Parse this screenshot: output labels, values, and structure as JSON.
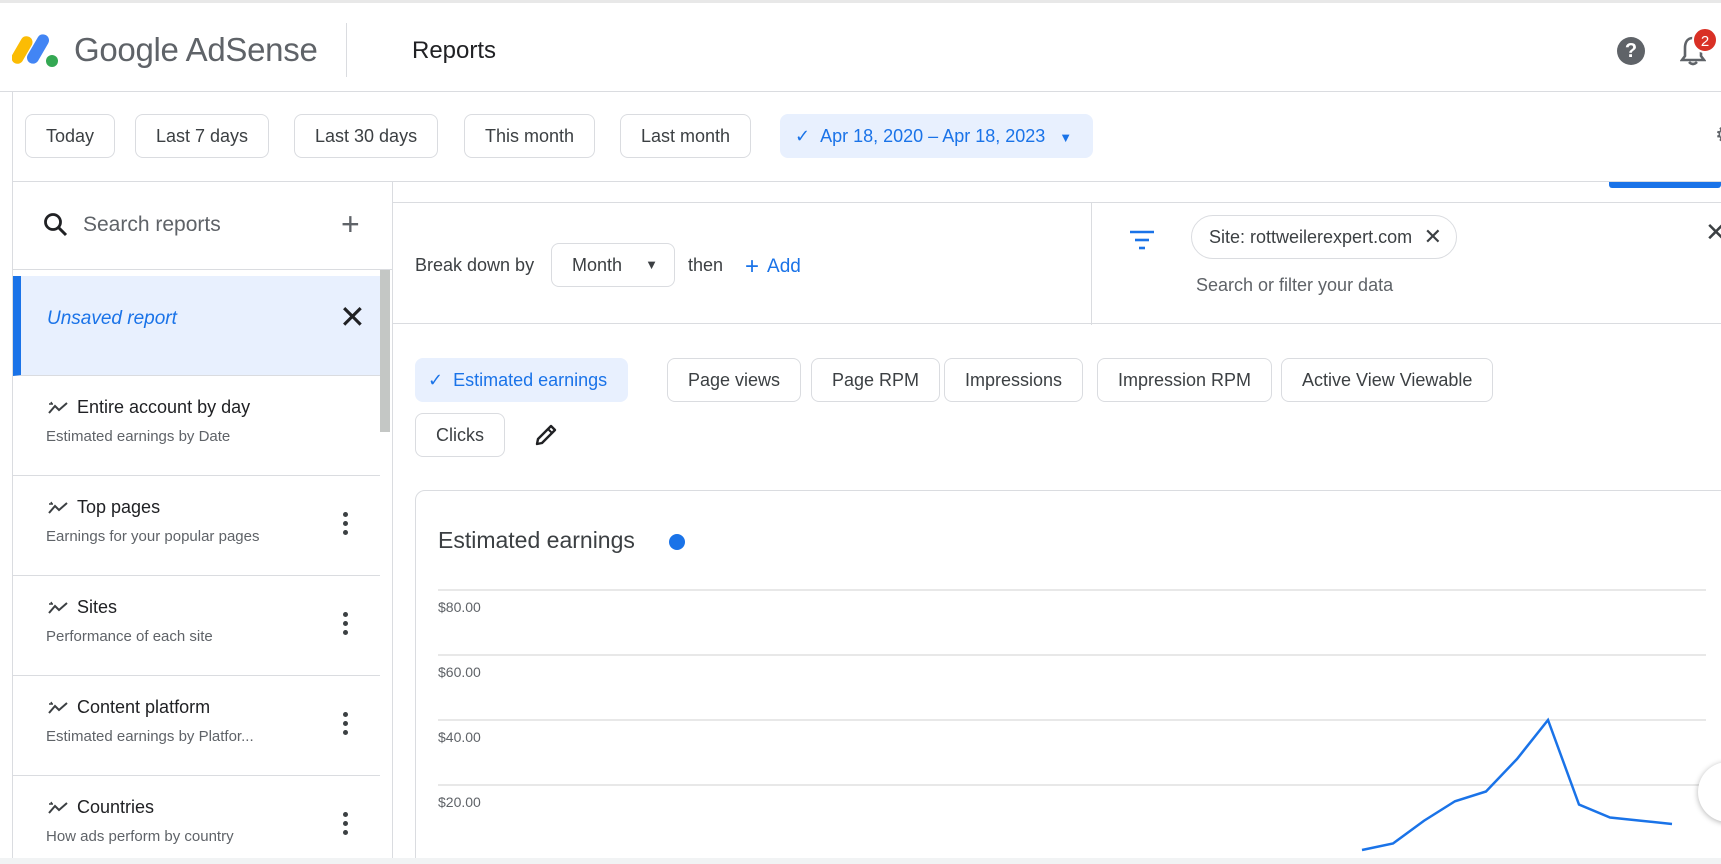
{
  "app": {
    "brand": "Google AdSense",
    "page_title": "Reports",
    "notifications_count": "2",
    "help_glyph": "?"
  },
  "date_range": {
    "chips": [
      "Today",
      "Last 7 days",
      "Last 30 days",
      "This month",
      "Last month"
    ],
    "selected": "Apr 18, 2020 – Apr 18, 2023"
  },
  "sidebar": {
    "search_placeholder": "Search reports",
    "unsaved_label": "Unsaved report",
    "reports": [
      {
        "title": "Entire account by day",
        "subtitle": "Estimated earnings by Date"
      },
      {
        "title": "Top pages",
        "subtitle": "Earnings for your popular pages"
      },
      {
        "title": "Sites",
        "subtitle": "Performance of each site"
      },
      {
        "title": "Content platform",
        "subtitle": "Estimated earnings by Platfor..."
      },
      {
        "title": "Countries",
        "subtitle": "How ads perform by country"
      }
    ]
  },
  "breakdown": {
    "label": "Break down by",
    "selected": "Month",
    "then": "then",
    "add": "Add"
  },
  "filter": {
    "chip": "Site: rottweilerexpert.com",
    "placeholder": "Search or filter your data"
  },
  "metrics": {
    "items": [
      "Estimated earnings",
      "Page views",
      "Page RPM",
      "Impressions",
      "Impression RPM",
      "Active View Viewable",
      "Clicks"
    ],
    "selected": "Estimated earnings"
  },
  "chart": {
    "title": "Estimated earnings",
    "series_color": "#1a73e8"
  },
  "chart_data": {
    "type": "line",
    "title": "Estimated earnings",
    "xlabel": "",
    "ylabel": "",
    "y_ticks": [
      "$80.00",
      "$60.00",
      "$40.00",
      "$20.00"
    ],
    "ylim": [
      0,
      80
    ],
    "grid": true,
    "series": [
      {
        "values": [
          0,
          2,
          9,
          15,
          18,
          28,
          40,
          14,
          10,
          9,
          8
        ]
      }
    ]
  },
  "colors": {
    "accent": "#1a73e8",
    "selected_bg": "#e8f0fe",
    "badge": "#d93025"
  }
}
